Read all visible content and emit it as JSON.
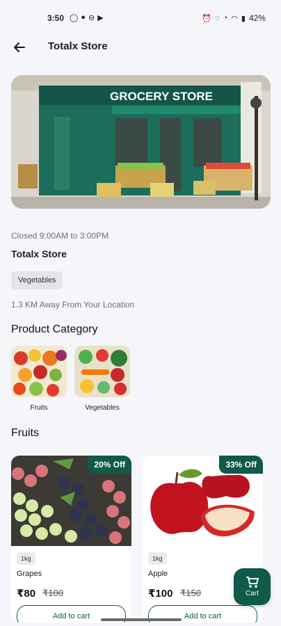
{
  "status_bar": {
    "time": "3:50",
    "left_icons": [
      "whatsapp-icon",
      "chat-icon",
      "sync-icon",
      "youtube-icon"
    ],
    "right_icons": [
      "alarm-icon",
      "mute-icon",
      "volte-icon",
      "wifi-icon",
      "signal-icon"
    ],
    "battery": "42%"
  },
  "app_bar": {
    "title": "Totalx Store"
  },
  "store": {
    "sign_text": "GROCERY STORE",
    "hours": "Closed 9:00AM to 3:00PM",
    "name": "Totalx Store",
    "tag": "Vegetables",
    "distance": "1.3 KM Away From Your Location"
  },
  "categories": {
    "title": "Product Category",
    "items": [
      {
        "label": "Fruits"
      },
      {
        "label": "Vegetables"
      }
    ]
  },
  "fruits": {
    "title": "Fruits",
    "products": [
      {
        "name": "Grapes",
        "unit": "1kg",
        "price": "₹80",
        "mrp": "₹100",
        "discount": "20% Off",
        "add_label": "Add to cart"
      },
      {
        "name": "Apple",
        "unit": "1kg",
        "price": "₹100",
        "mrp": "₹150",
        "discount": "33% Off",
        "add_label": "Add to cart"
      }
    ]
  },
  "cart": {
    "label": "Cart"
  },
  "colors": {
    "brand": "#0f5a49",
    "background": "#f4f6fa"
  }
}
